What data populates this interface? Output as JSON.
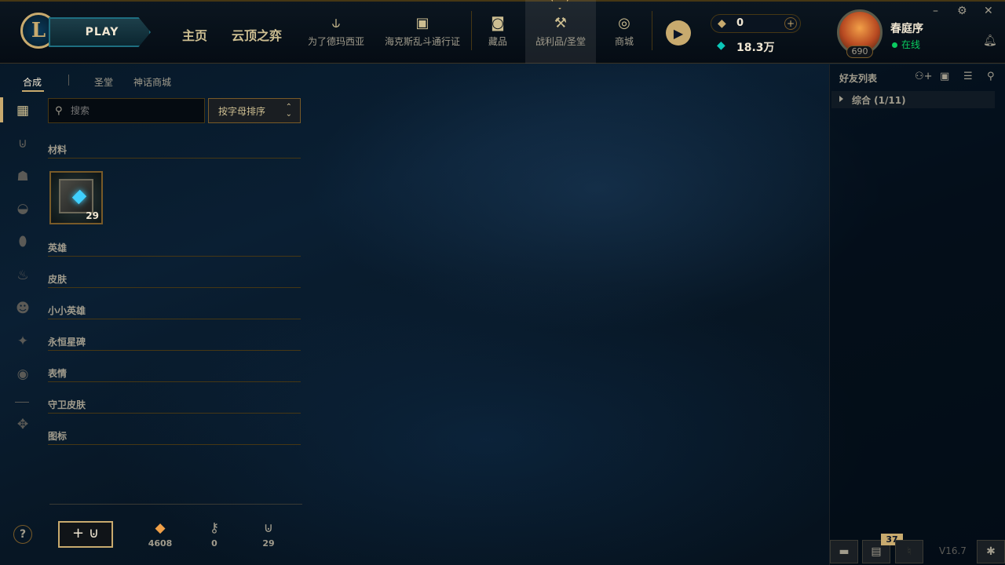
{
  "nav": {
    "play": "PLAY",
    "home": "主页",
    "tft": "云顶之弈",
    "demacia": "为了德玛西亚",
    "hextech_pass": "海克斯乱斗通行证",
    "collection": "藏品",
    "loot": "战利品/圣堂",
    "store": "商城"
  },
  "currency": {
    "rp": "0",
    "be": "18.3万"
  },
  "profile": {
    "name": "春庭序",
    "status": "在线",
    "level": "690"
  },
  "subtabs": [
    "合成",
    "圣堂",
    "神话商城"
  ],
  "search": {
    "placeholder": "搜索"
  },
  "sort": {
    "label": "按字母排序"
  },
  "categories": {
    "materials": "材料",
    "champions": "英雄",
    "skins": "皮肤",
    "tacticians": "小小英雄",
    "eternals": "永恒星碑",
    "emotes": "表情",
    "ward_skins": "守卫皮肤",
    "icons": "图标"
  },
  "materials": [
    {
      "name": "chest",
      "count": "29"
    }
  ],
  "bottom": {
    "orange_essence": "4608",
    "keys": "0",
    "chests": "29"
  },
  "friends": {
    "title": "好友列表",
    "group": "综合 (1/11)"
  },
  "footer": {
    "badge": "37",
    "version": "V16.7"
  },
  "icons": {
    "help": "help-icon",
    "craft": "craft-chest-icon"
  },
  "colors": {
    "gold": "#c8aa6e",
    "online": "#0acb60",
    "blue_essence": "#0ac8b9",
    "orange_essence": "#f0a048"
  }
}
